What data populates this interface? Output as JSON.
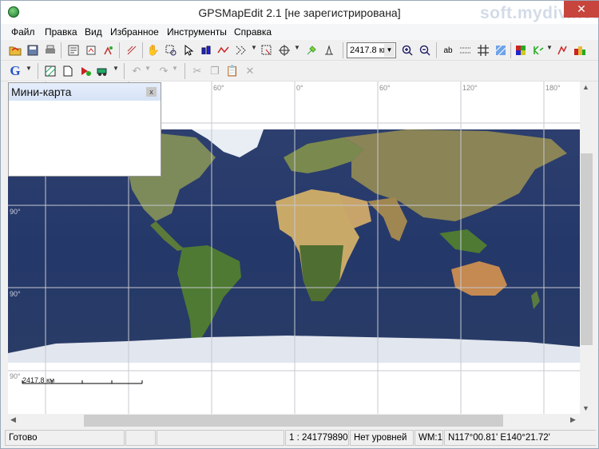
{
  "window": {
    "title": "GPSMapEdit 2.1 [не зарегистрирована]",
    "watermark": "soft.mydiv.net",
    "close_glyph": "✕"
  },
  "menu": [
    "Файл",
    "Правка",
    "Вид",
    "Избранное",
    "Инструменты",
    "Справка"
  ],
  "toolbar": {
    "scale_value": "2417.8 км",
    "google_label": "G",
    "label_button": "ab",
    "icons": [
      "open-icon",
      "save-icon",
      "print-icon",
      "properties-icon",
      "import-icon",
      "hand-icon",
      "zoom-rect-icon",
      "select-icon",
      "edit-node-icon",
      "draw-line-icon",
      "zoom-in-icon",
      "zoom-out-icon",
      "grid-icon",
      "undo-icon",
      "redo-icon",
      "cut-icon",
      "copy-icon",
      "paste-icon",
      "delete-icon"
    ]
  },
  "map": {
    "top_degrees": [
      "60°",
      "0°",
      "60°",
      "120°",
      "180°"
    ],
    "side_degrees": [
      "90°",
      "90°",
      "90°"
    ],
    "scale_bar_label": "2417.8 км"
  },
  "minimap": {
    "title": "Мини-карта",
    "close": "x"
  },
  "status": {
    "ready": "Готово",
    "scale": "1 : 241779890",
    "levels": "Нет уровней",
    "wm": "WM:1",
    "coords": "N117°00.81' E140°21.72'"
  }
}
